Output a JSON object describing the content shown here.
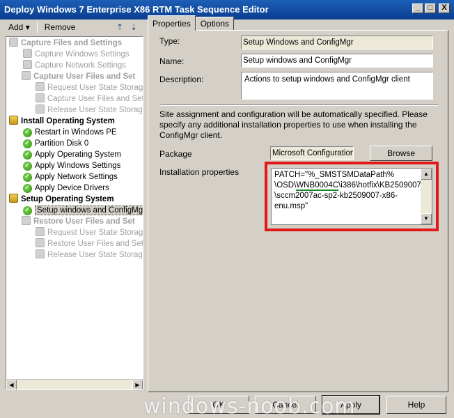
{
  "window": {
    "title": "Deploy Windows 7 Enterprise X86 RTM Task Sequence Editor",
    "minimize": "_",
    "maximize": "□",
    "close": "X"
  },
  "toolbar": {
    "add_label": "Add",
    "remove_label": "Remove"
  },
  "tree": [
    {
      "label": "Capture Files and Settings",
      "kind": "group",
      "disabled": true
    },
    {
      "label": "Capture Windows Settings",
      "kind": "item",
      "disabled": true
    },
    {
      "label": "Capture Network Settings",
      "kind": "item",
      "disabled": true
    },
    {
      "label": "Capture User Files and Set",
      "kind": "group",
      "disabled": true
    },
    {
      "label": "Request User State Storag",
      "kind": "item",
      "disabled": true
    },
    {
      "label": "Capture User Files and Set",
      "kind": "item",
      "disabled": true
    },
    {
      "label": "Release User State Storag",
      "kind": "item",
      "disabled": true
    },
    {
      "label": "Install Operating System",
      "kind": "group",
      "disabled": false
    },
    {
      "label": "Restart in Windows PE",
      "kind": "item",
      "disabled": false
    },
    {
      "label": "Partition Disk 0",
      "kind": "item",
      "disabled": false
    },
    {
      "label": "Apply Operating System",
      "kind": "item",
      "disabled": false
    },
    {
      "label": "Apply Windows Settings",
      "kind": "item",
      "disabled": false
    },
    {
      "label": "Apply Network Settings",
      "kind": "item",
      "disabled": false
    },
    {
      "label": "Apply Device Drivers",
      "kind": "item",
      "disabled": false
    },
    {
      "label": "Setup Operating System",
      "kind": "group",
      "disabled": false
    },
    {
      "label": "Setup windows and ConfigMgr",
      "kind": "item",
      "disabled": false,
      "selected": true
    },
    {
      "label": "Restore User Files and Set",
      "kind": "group",
      "disabled": true
    },
    {
      "label": "Request User State Storag",
      "kind": "item",
      "disabled": true
    },
    {
      "label": "Restore User Files and Set",
      "kind": "item",
      "disabled": true
    },
    {
      "label": "Release User State Storag",
      "kind": "item",
      "disabled": true
    }
  ],
  "tabs": {
    "properties": "Properties",
    "options": "Options"
  },
  "form": {
    "type_label": "Type:",
    "type_value": "Setup Windows and ConfigMgr",
    "name_label": "Name:",
    "name_value": "Setup windows and ConfigMgr",
    "description_label": "Description:",
    "description_value": "Actions to setup windows and ConfigMgr client",
    "info_text": "Site assignment and configuration will be automatically specified. Please specify any additional installation properties to use when installing the ConfigMgr client.",
    "package_label": "Package",
    "package_value": "Microsoft Configuration",
    "browse_label": "Browse",
    "install_props_label": "Installation properties",
    "install_props": {
      "line1": "PATCH=\"%_SMSTSMDataPath%",
      "line2_a": "\\OSD\\",
      "line2_b": "WNB0004C",
      "line2_c": "\\i386\\hotfix\\KB2509007",
      "line3": "\\sccm2007ac-sp2-kb2509007-x86-",
      "line4": "enu.msp\""
    }
  },
  "buttons": {
    "ok": "OK",
    "cancel": "Cancel",
    "apply": "Apply",
    "help": "Help"
  },
  "watermark": "windows-noob.com",
  "colors": {
    "highlight_box": "#e01818",
    "underline": "#1a8a2a",
    "titlebar": "#0a3d8f"
  }
}
